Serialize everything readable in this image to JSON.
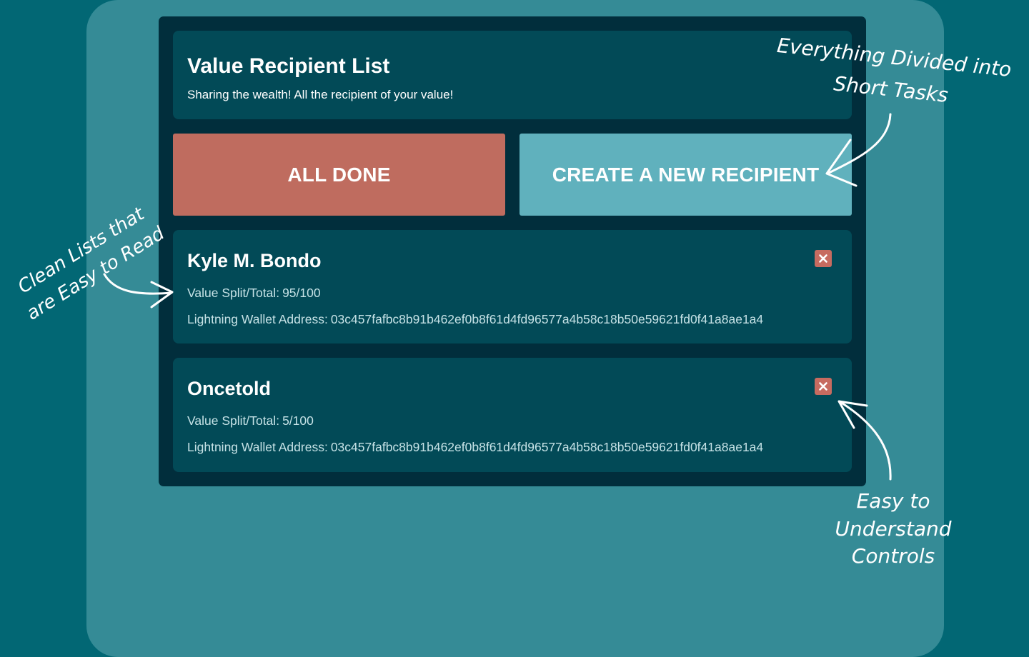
{
  "header": {
    "title": "Value Recipient List",
    "subtitle": "Sharing the wealth! All the recipient of your value!"
  },
  "actions": {
    "all_done_label": "ALL DONE",
    "create_label": "CREATE A NEW RECIPIENT"
  },
  "recipients": [
    {
      "name": "Kyle M. Bondo",
      "split_label": "Value Split/Total:",
      "split_value": "95/100",
      "address_label": "Lightning Wallet Address:",
      "address_value": "03c457fafbc8b91b462ef0b8f61d4fd96577a4b58c18b50e59621fd0f41a8ae1a4"
    },
    {
      "name": "Oncetold",
      "split_label": "Value Split/Total:",
      "split_value": "5/100",
      "address_label": "Lightning Wallet Address:",
      "address_value": "03c457fafbc8b91b462ef0b8f61d4fd96577a4b58c18b50e59621fd0f41a8ae1a4"
    }
  ],
  "annotations": {
    "top": [
      "Everything Divided into",
      "Short Tasks"
    ],
    "left": [
      "Clean Lists that",
      "are Easy to Read"
    ],
    "bottom": [
      "Easy to",
      "Understand",
      "Controls"
    ]
  },
  "icons": {
    "remove": "close-icon"
  },
  "colors": {
    "background": "#026774",
    "backdrop": "#358b96",
    "panel": "#012e3c",
    "card": "#024a57",
    "all_done": "#bf6c5f",
    "create": "#60b1bd",
    "remove": "#c76b60"
  }
}
